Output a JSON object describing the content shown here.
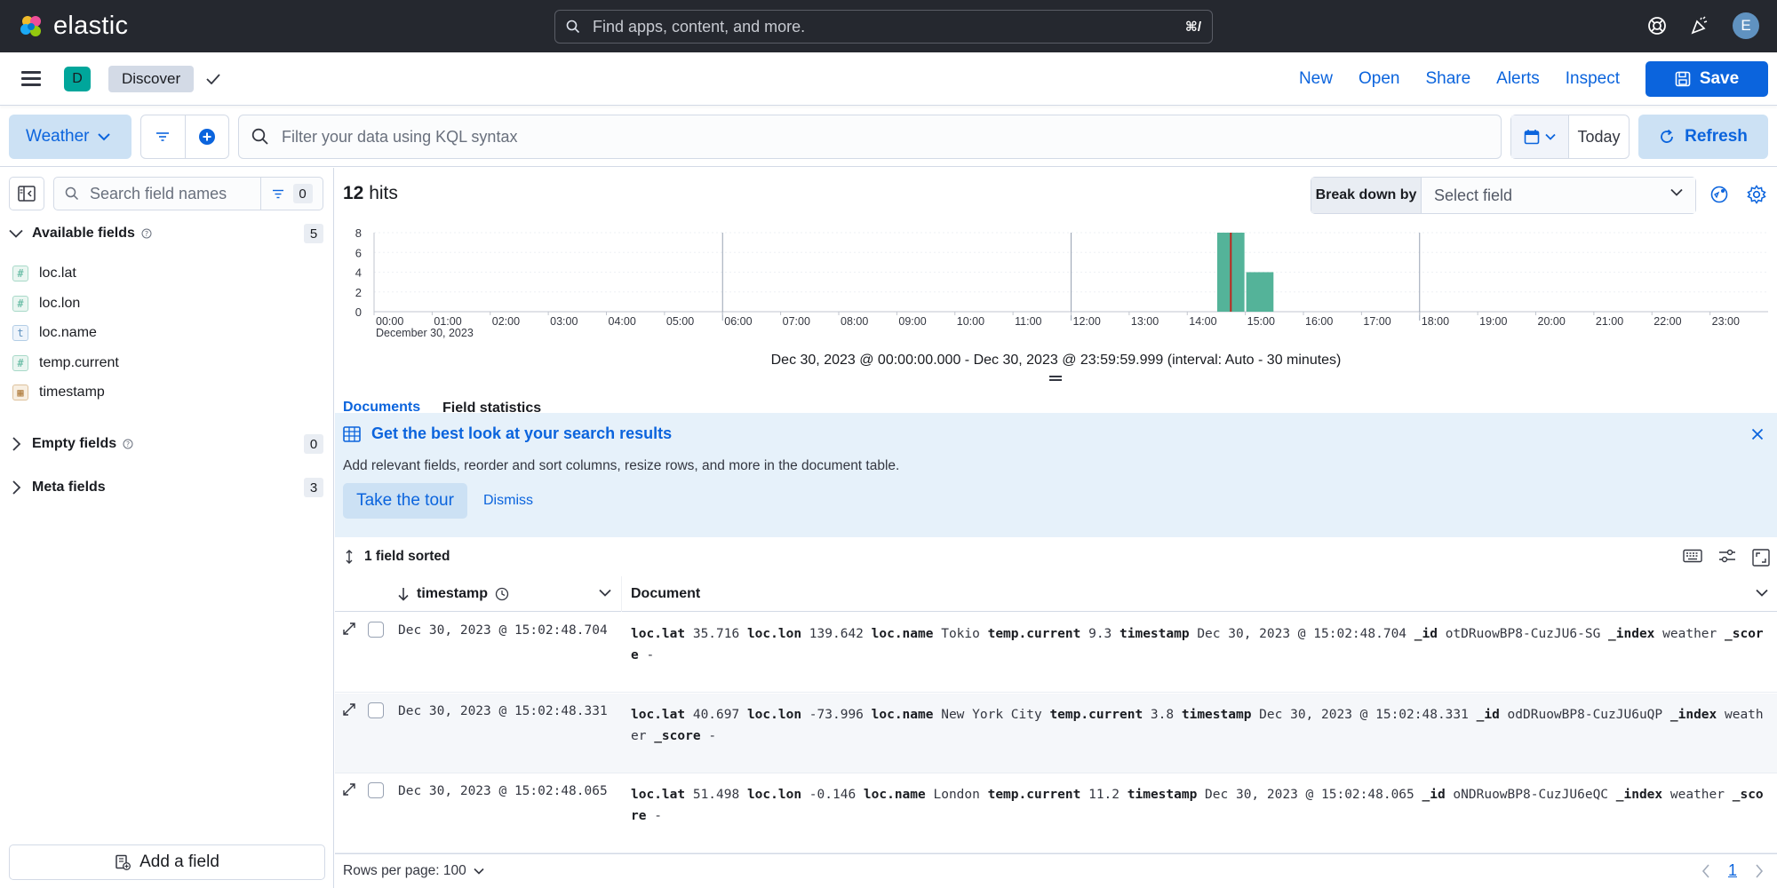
{
  "header": {
    "brand": "elastic",
    "search_placeholder": "Find apps, content, and more.",
    "search_shortcut": "⌘/",
    "user_initial": "E"
  },
  "appbar": {
    "space_initial": "D",
    "breadcrumb": "Discover",
    "actions": [
      "New",
      "Open",
      "Share",
      "Alerts",
      "Inspect"
    ],
    "save_label": "Save"
  },
  "querybar": {
    "data_view": "Weather",
    "kql_placeholder": "Filter your data using KQL syntax",
    "date": "Today",
    "refresh_label": "Refresh"
  },
  "sidebar": {
    "search_placeholder": "Search field names",
    "filter_count": "0",
    "available_label": "Available fields",
    "available_count": "5",
    "fields": [
      {
        "type": "num",
        "glyph": "#",
        "name": "loc.lat"
      },
      {
        "type": "num",
        "glyph": "#",
        "name": "loc.lon"
      },
      {
        "type": "str",
        "glyph": "t",
        "name": "loc.name"
      },
      {
        "type": "num",
        "glyph": "#",
        "name": "temp.current"
      },
      {
        "type": "date",
        "glyph": "▦",
        "name": "timestamp"
      }
    ],
    "empty_label": "Empty fields",
    "empty_count": "0",
    "meta_label": "Meta fields",
    "meta_count": "3",
    "add_field_label": "Add a field"
  },
  "main": {
    "hits_count": "12",
    "hits_label": "hits",
    "breakdown_label": "Break down by",
    "breakdown_placeholder": "Select field",
    "time_range": "Dec 30, 2023 @ 00:00:00.000 - Dec 30, 2023 @ 23:59:59.999 (interval: Auto - 30 minutes)",
    "tabs": [
      "Documents",
      "Field statistics"
    ],
    "callout_title": "Get the best look at your search results",
    "callout_body": "Add relevant fields, reorder and sort columns, resize rows, and more in the document table.",
    "tour_label": "Take the tour",
    "dismiss_label": "Dismiss",
    "sorted_label": "1 field sorted",
    "col_timestamp": "timestamp",
    "col_document": "Document",
    "rows_per_page": "Rows per page: 100",
    "current_page": "1"
  },
  "chart_data": {
    "type": "bar",
    "date_label": "December 30, 2023",
    "x_ticks": [
      "00:00",
      "01:00",
      "02:00",
      "03:00",
      "04:00",
      "05:00",
      "06:00",
      "07:00",
      "08:00",
      "09:00",
      "10:00",
      "11:00",
      "12:00",
      "13:00",
      "14:00",
      "15:00",
      "16:00",
      "17:00",
      "18:00",
      "19:00",
      "20:00",
      "21:00",
      "22:00",
      "23:00"
    ],
    "y_ticks": [
      "0",
      "2",
      "4",
      "6",
      "8"
    ],
    "ylim": [
      0,
      8
    ],
    "bars": [
      {
        "bucket": "14:30",
        "value": 8
      },
      {
        "bucket": "15:00",
        "value": 4
      }
    ],
    "bar_color": "#54b399",
    "now_marker": "14:45"
  },
  "rows": [
    {
      "timestamp": "Dec 30, 2023 @ 15:02:48.704",
      "doc": [
        [
          "loc.lat",
          "35.716"
        ],
        [
          "loc.lon",
          "139.642"
        ],
        [
          "loc.name",
          "Tokio"
        ],
        [
          "temp.current",
          "9.3"
        ],
        [
          "timestamp",
          "Dec 30, 2023 @ 15:02:48.704"
        ],
        [
          "_id",
          "otDRuowBP8-CuzJU6-SG"
        ],
        [
          "_index",
          "weather"
        ],
        [
          "_score",
          "-"
        ]
      ]
    },
    {
      "timestamp": "Dec 30, 2023 @ 15:02:48.331",
      "doc": [
        [
          "loc.lat",
          "40.697"
        ],
        [
          "loc.lon",
          "-73.996"
        ],
        [
          "loc.name",
          "New York City"
        ],
        [
          "temp.current",
          "3.8"
        ],
        [
          "timestamp",
          "Dec 30, 2023 @ 15:02:48.331"
        ],
        [
          "_id",
          "odDRuowBP8-CuzJU6uQP"
        ],
        [
          "_index",
          "weather"
        ],
        [
          "_score",
          "-"
        ]
      ]
    },
    {
      "timestamp": "Dec 30, 2023 @ 15:02:48.065",
      "doc": [
        [
          "loc.lat",
          "51.498"
        ],
        [
          "loc.lon",
          "-0.146"
        ],
        [
          "loc.name",
          "London"
        ],
        [
          "temp.current",
          "11.2"
        ],
        [
          "timestamp",
          "Dec 30, 2023 @ 15:02:48.065"
        ],
        [
          "_id",
          "oNDRuowBP8-CuzJU6eQC"
        ],
        [
          "_index",
          "weather"
        ],
        [
          "_score",
          "-"
        ]
      ]
    }
  ]
}
